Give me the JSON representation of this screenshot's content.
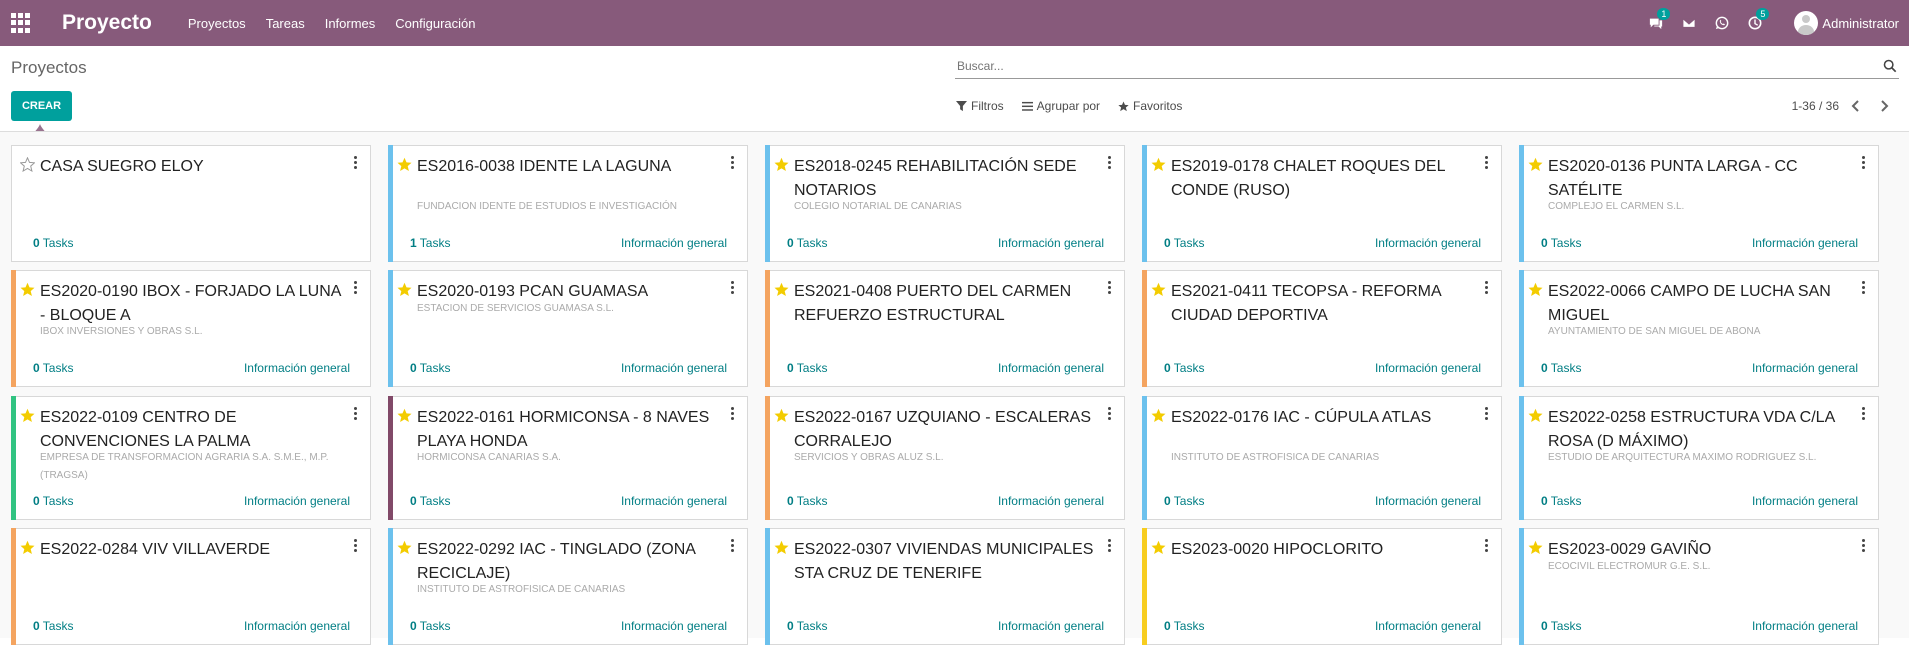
{
  "navbar": {
    "app_title": "Proyecto",
    "menu": [
      "Proyectos",
      "Tareas",
      "Informes",
      "Configuración"
    ],
    "messages_badge": "1",
    "activities_badge": "5",
    "user_name": "Administrator"
  },
  "control_panel": {
    "page_title": "Proyectos",
    "search_placeholder": "Buscar...",
    "create_label": "CREAR",
    "filters_label": "Filtros",
    "group_by_label": "Agrupar por",
    "favorites_label": "Favoritos",
    "pager_text": "1-36 / 36"
  },
  "colors": {
    "navbar": "#875a7b",
    "accent": "#00a09d",
    "link": "#017e84",
    "star": "#f3cc00",
    "strip_blue": "#6cc1ed",
    "strip_orange": "#f4a460",
    "strip_green": "#30c381",
    "strip_purple": "#814968",
    "strip_yellow": "#f7cd1f"
  },
  "cards": [
    {
      "title": "CASA SUEGRO ELOY",
      "subtitle": "",
      "tasks": "0",
      "tasks_suffix": "Tasks",
      "info": "",
      "favorite": false,
      "color": ""
    },
    {
      "title": "ES2016-0038 IDENTE LA LAGUNA",
      "subtitle": "FUNDACION IDENTE DE ESTUDIOS E INVESTIGACIÓN",
      "tasks": "1",
      "tasks_suffix": "Tasks",
      "info": "Información general",
      "favorite": true,
      "color": "#6cc1ed"
    },
    {
      "title": "ES2018-0245 REHABILITACIÓN SEDE NOTARIOS",
      "subtitle": "COLEGIO NOTARIAL DE CANARIAS",
      "tasks": "0",
      "tasks_suffix": "Tasks",
      "info": "Información general",
      "favorite": true,
      "color": "#6cc1ed"
    },
    {
      "title": "ES2019-0178 CHALET ROQUES DEL CONDE (RUSO)",
      "subtitle": "",
      "tasks": "0",
      "tasks_suffix": "Tasks",
      "info": "Información general",
      "favorite": true,
      "color": "#6cc1ed"
    },
    {
      "title": "ES2020-0136 PUNTA LARGA - CC SATÉLITE",
      "subtitle": "COMPLEJO EL CARMEN S.L.",
      "tasks": "0",
      "tasks_suffix": "Tasks",
      "info": "Información general",
      "favorite": true,
      "color": "#6cc1ed"
    },
    {
      "title": "ES2020-0190 IBOX - FORJADO LA LUNA - BLOQUE A",
      "subtitle": "IBOX INVERSIONES Y OBRAS S.L.",
      "tasks": "0",
      "tasks_suffix": "Tasks",
      "info": "Información general",
      "favorite": true,
      "color": "#f4a460"
    },
    {
      "title": "ES2020-0193 PCAN GUAMASA",
      "subtitle": "ESTACION DE SERVICIOS GUAMASA S.L.",
      "tasks": "0",
      "tasks_suffix": "Tasks",
      "info": "Información general",
      "favorite": true,
      "color": "#6cc1ed"
    },
    {
      "title": "ES2021-0408 PUERTO DEL CARMEN REFUERZO ESTRUCTURAL",
      "subtitle": "",
      "tasks": "0",
      "tasks_suffix": "Tasks",
      "info": "Información general",
      "favorite": true,
      "color": "#f4a460"
    },
    {
      "title": "ES2021-0411 TECOPSA - REFORMA CIUDAD DEPORTIVA",
      "subtitle": "",
      "tasks": "0",
      "tasks_suffix": "Tasks",
      "info": "Información general",
      "favorite": true,
      "color": "#f4a460"
    },
    {
      "title": "ES2022-0066 CAMPO DE LUCHA SAN MIGUEL",
      "subtitle": "AYUNTAMIENTO DE SAN MIGUEL DE ABONA",
      "tasks": "0",
      "tasks_suffix": "Tasks",
      "info": "Información general",
      "favorite": true,
      "color": "#6cc1ed"
    },
    {
      "title": "ES2022-0109 CENTRO DE CONVENCIONES LA PALMA",
      "subtitle": "EMPRESA DE TRANSFORMACION AGRARIA S.A. S.M.E., M.P. (TRAGSA)",
      "tasks": "0",
      "tasks_suffix": "Tasks",
      "info": "Información general",
      "favorite": true,
      "color": "#30c381"
    },
    {
      "title": "ES2022-0161 HORMICONSA - 8 NAVES PLAYA HONDA",
      "subtitle": "HORMICONSA CANARIAS S.A.",
      "tasks": "0",
      "tasks_suffix": "Tasks",
      "info": "Información general",
      "favorite": true,
      "color": "#814968"
    },
    {
      "title": "ES2022-0167 UZQUIANO - ESCALERAS CORRALEJO",
      "subtitle": "SERVICIOS Y OBRAS ALUZ S.L.",
      "tasks": "0",
      "tasks_suffix": "Tasks",
      "info": "Información general",
      "favorite": true,
      "color": "#f4a460"
    },
    {
      "title": "ES2022-0176 IAC - CÚPULA ATLAS",
      "subtitle": "INSTITUTO DE ASTROFISICA DE CANARIAS",
      "tasks": "0",
      "tasks_suffix": "Tasks",
      "info": "Información general",
      "favorite": true,
      "color": "#6cc1ed"
    },
    {
      "title": "ES2022-0258 ESTRUCTURA VDA C/LA ROSA (D MÁXIMO)",
      "subtitle": "ESTUDIO DE ARQUITECTURA MAXIMO RODRIGUEZ S.L.",
      "tasks": "0",
      "tasks_suffix": "Tasks",
      "info": "Información general",
      "favorite": true,
      "color": "#6cc1ed"
    },
    {
      "title": "ES2022-0284 VIV VILLAVERDE",
      "subtitle": "",
      "tasks": "0",
      "tasks_suffix": "Tasks",
      "info": "Información general",
      "favorite": true,
      "color": "#f4a460"
    },
    {
      "title": "ES2022-0292 IAC - TINGLADO (ZONA RECICLAJE)",
      "subtitle": "INSTITUTO DE ASTROFISICA DE CANARIAS",
      "tasks": "0",
      "tasks_suffix": "Tasks",
      "info": "Información general",
      "favorite": true,
      "color": "#6cc1ed"
    },
    {
      "title": "ES2022-0307 VIVIENDAS MUNICIPALES STA CRUZ DE TENERIFE",
      "subtitle": "",
      "tasks": "0",
      "tasks_suffix": "Tasks",
      "info": "Información general",
      "favorite": true,
      "color": "#6cc1ed"
    },
    {
      "title": "ES2023-0020 HIPOCLORITO",
      "subtitle": "",
      "tasks": "0",
      "tasks_suffix": "Tasks",
      "info": "Información general",
      "favorite": true,
      "color": "#f7cd1f"
    },
    {
      "title": "ES2023-0029 GAVIÑO",
      "subtitle": "ECOCIVIL ELECTROMUR G.E. S.L.",
      "tasks": "0",
      "tasks_suffix": "Tasks",
      "info": "Información general",
      "favorite": true,
      "color": "#6cc1ed"
    }
  ]
}
